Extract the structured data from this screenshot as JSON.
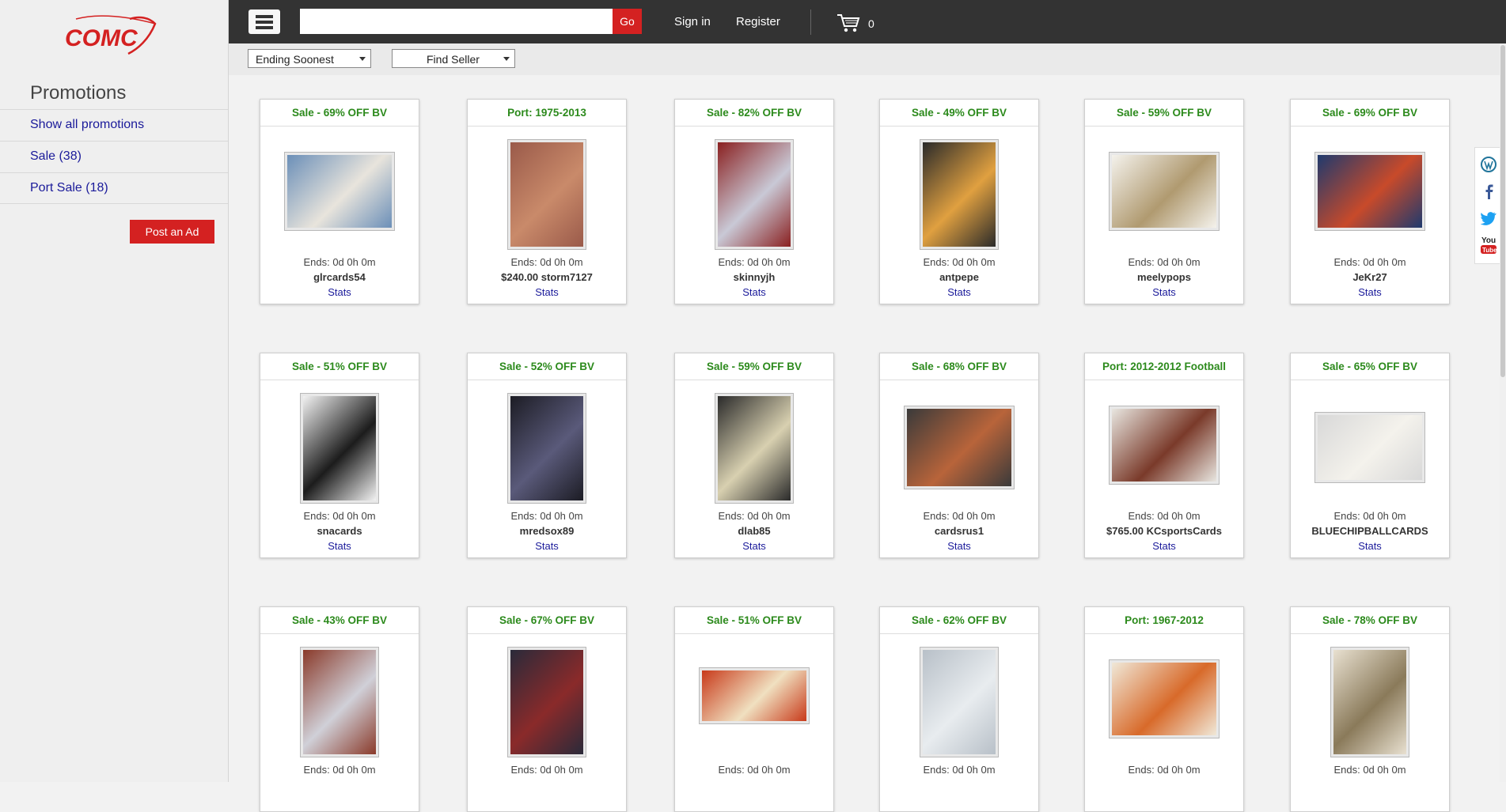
{
  "brand": {
    "logo_text": "COMC"
  },
  "sidebar": {
    "title": "Promotions",
    "links": [
      {
        "label": "Show all promotions"
      },
      {
        "label": "Sale (38)"
      },
      {
        "label": "Port Sale (18)"
      }
    ],
    "post_ad_label": "Post an Ad"
  },
  "topbar": {
    "search_value": "",
    "go_label": "Go",
    "signin_label": "Sign in",
    "register_label": "Register",
    "cart_count": "0"
  },
  "filters": {
    "sort_selected": "Ending Soonest",
    "seller_selected": "Find Seller"
  },
  "cards": [
    {
      "header": "Sale - 69% OFF BV",
      "ends": "Ends: 0d 0h 0m",
      "seller": "glrcards54",
      "stats": "Stats",
      "c1": "#6b8fb8",
      "c2": "#e8e4dc"
    },
    {
      "header": "Port: 1975-2013",
      "ends": "Ends: 0d 0h 0m",
      "seller": "$240.00 storm7127",
      "stats": "Stats",
      "c1": "#9a5a4a",
      "c2": "#c98a6a"
    },
    {
      "header": "Sale - 82% OFF BV",
      "ends": "Ends: 0d 0h 0m",
      "seller": "skinnyjh",
      "stats": "Stats",
      "c1": "#8a2020",
      "c2": "#c9c9d6"
    },
    {
      "header": "Sale - 49% OFF BV",
      "ends": "Ends: 0d 0h 0m",
      "seller": "antpepe",
      "stats": "Stats",
      "c1": "#2a2a2a",
      "c2": "#e0a040"
    },
    {
      "header": "Sale - 59% OFF BV",
      "ends": "Ends: 0d 0h 0m",
      "seller": "meelypops",
      "stats": "Stats",
      "c1": "#f4f2ec",
      "c2": "#b09a70"
    },
    {
      "header": "Sale - 69% OFF BV",
      "ends": "Ends: 0d 0h 0m",
      "seller": "JeKr27",
      "stats": "Stats",
      "c1": "#1f3a6e",
      "c2": "#c84a2a"
    },
    {
      "header": "Sale - 51% OFF BV",
      "ends": "Ends: 0d 0h 0m",
      "seller": "snacards",
      "stats": "Stats",
      "c1": "#f2f2f2",
      "c2": "#1c1c1c"
    },
    {
      "header": "Sale - 52% OFF BV",
      "ends": "Ends: 0d 0h 0m",
      "seller": "mredsox89",
      "stats": "Stats",
      "c1": "#1c1c24",
      "c2": "#5a5a7a"
    },
    {
      "header": "Sale - 59% OFF BV",
      "ends": "Ends: 0d 0h 0m",
      "seller": "dlab85",
      "stats": "Stats",
      "c1": "#2a2a2a",
      "c2": "#d8d0b0"
    },
    {
      "header": "Sale - 68% OFF BV",
      "ends": "Ends: 0d 0h 0m",
      "seller": "cardsrus1",
      "stats": "Stats",
      "c1": "#3a3a3a",
      "c2": "#b8643a"
    },
    {
      "header": "Port: 2012-2012 Football",
      "ends": "Ends: 0d 0h 0m",
      "seller": "$765.00 KCsportsCards",
      "stats": "Stats",
      "c1": "#e8e6e0",
      "c2": "#7a3a2a"
    },
    {
      "header": "Sale - 65% OFF BV",
      "ends": "Ends: 0d 0h 0m",
      "seller": "BLUECHIPBALLCARDS",
      "stats": "Stats",
      "c1": "#d8d8d8",
      "c2": "#f4f2ec"
    },
    {
      "header": "Sale - 43% OFF BV",
      "ends": "Ends: 0d 0h 0m",
      "seller": "",
      "stats": "",
      "c1": "#8a3a2a",
      "c2": "#d0d0d8"
    },
    {
      "header": "Sale - 67% OFF BV",
      "ends": "Ends: 0d 0h 0m",
      "seller": "",
      "stats": "",
      "c1": "#2a2a3a",
      "c2": "#8a2a2a"
    },
    {
      "header": "Sale - 51% OFF BV",
      "ends": "Ends: 0d 0h 0m",
      "seller": "",
      "stats": "",
      "c1": "#c83a1a",
      "c2": "#f0e0c0"
    },
    {
      "header": "Sale - 62% OFF BV",
      "ends": "Ends: 0d 0h 0m",
      "seller": "",
      "stats": "",
      "c1": "#b8c0c8",
      "c2": "#e8ecef"
    },
    {
      "header": "Port: 1967-2012",
      "ends": "Ends: 0d 0h 0m",
      "seller": "",
      "stats": "",
      "c1": "#f0e8d8",
      "c2": "#d86a2a"
    },
    {
      "header": "Sale - 78% OFF BV",
      "ends": "Ends: 0d 0h 0m",
      "seller": "",
      "stats": "",
      "c1": "#e8e0d0",
      "c2": "#8a7a5a"
    }
  ],
  "social": [
    "wordpress-icon",
    "facebook-icon",
    "twitter-icon",
    "youtube-icon"
  ],
  "colors": {
    "accent": "#d42121",
    "topbar": "#333333",
    "sale_green": "#2c8a1c",
    "link_blue": "#1a1a9a"
  }
}
